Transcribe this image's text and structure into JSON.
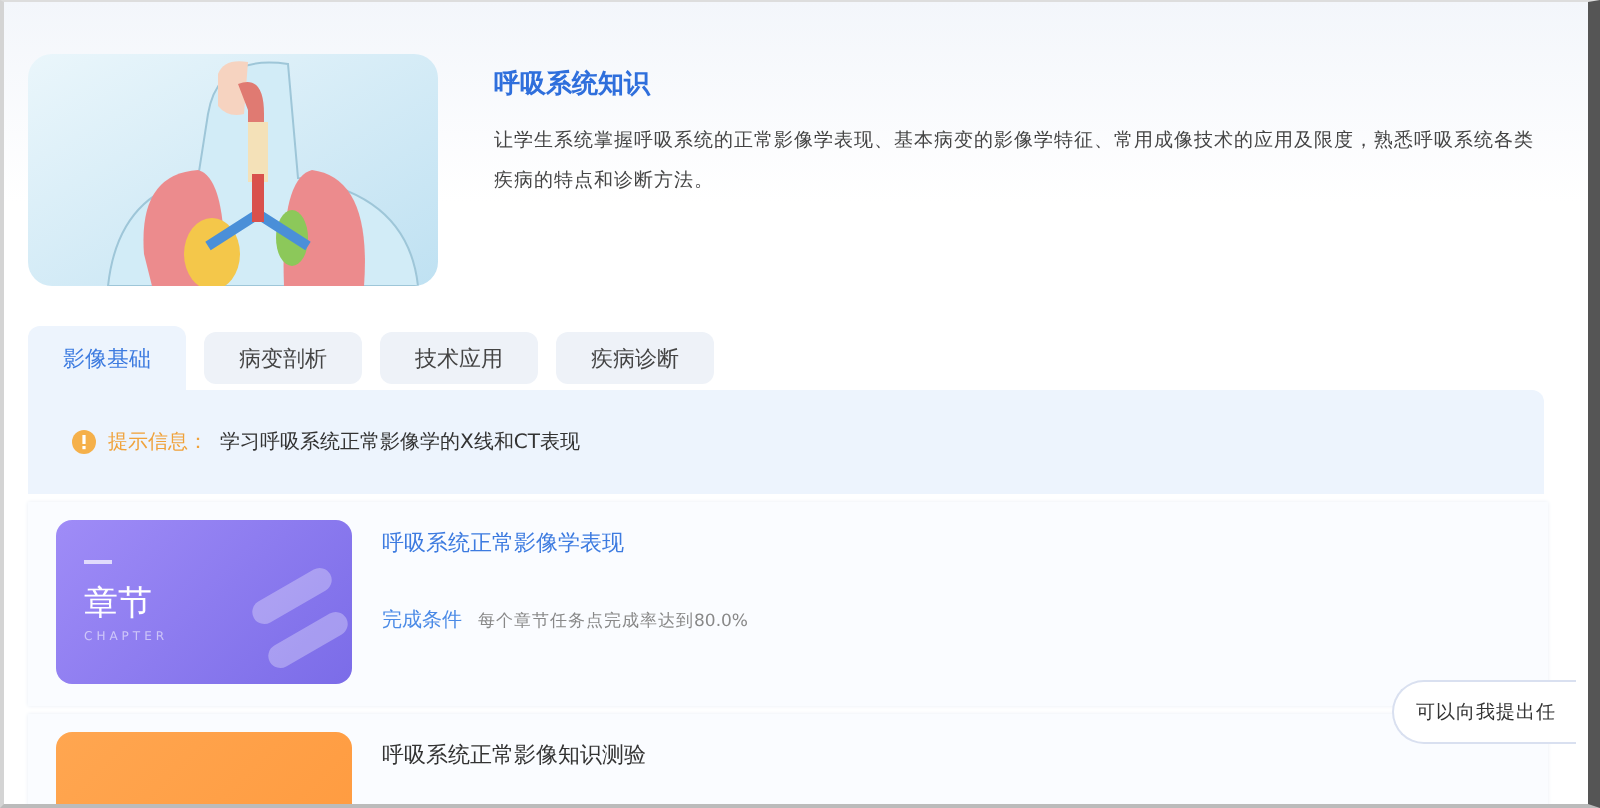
{
  "course": {
    "title": "呼吸系统知识",
    "description": "让学生系统掌握呼吸系统的正常影像学表现、基本病变的影像学特征、常用成像技术的应用及限度，熟悉呼吸系统各类疾病的特点和诊断方法。"
  },
  "tabs": [
    {
      "label": "影像基础",
      "selected": true
    },
    {
      "label": "病变剖析",
      "selected": false
    },
    {
      "label": "技术应用",
      "selected": false
    },
    {
      "label": "疾病诊断",
      "selected": false
    }
  ],
  "notice": {
    "label": "提示信息：",
    "text": "学习呼吸系统正常影像学的X线和CT表现"
  },
  "items": [
    {
      "kind": "chapter",
      "badge": "章节",
      "badge_sub": "CHAPTER",
      "title": "呼吸系统正常影像学表现",
      "condition_label": "完成条件",
      "condition": "每个章节任务点完成率达到80.0%"
    },
    {
      "kind": "quiz",
      "title": "呼吸系统正常影像知识测验"
    }
  ],
  "assistant_bubble": "可以向我提出任"
}
